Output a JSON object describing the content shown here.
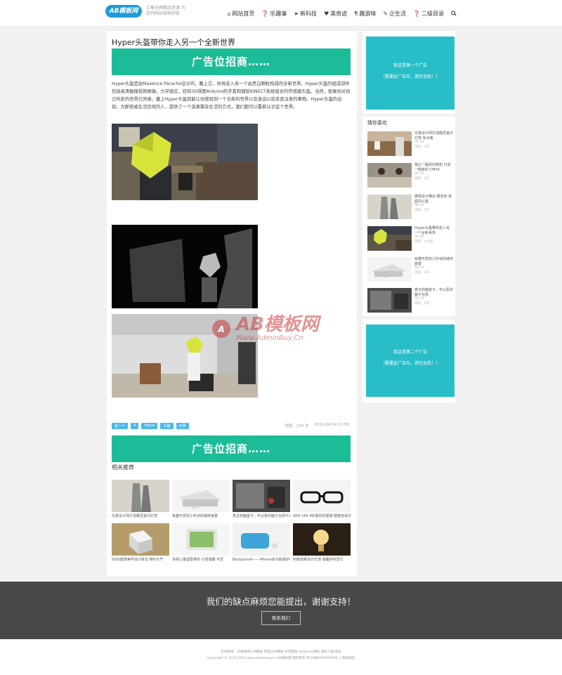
{
  "header": {
    "logo_text": "AB模板网",
    "logo_tagline": "汇聚全网精品资源 为您的网站保驾护航",
    "nav": [
      {
        "icon": "home-icon",
        "glyph": "⌂",
        "label": "网站首页"
      },
      {
        "icon": "help-icon",
        "glyph": "❓",
        "label": "乐趣事"
      },
      {
        "icon": "send-icon",
        "glyph": "➤",
        "label": "新科技"
      },
      {
        "icon": "heart-icon",
        "glyph": "♥",
        "label": "美奇迹"
      },
      {
        "icon": "cutlery-icon",
        "glyph": "¶",
        "label": "趣游味"
      },
      {
        "icon": "tag-icon",
        "glyph": "✎",
        "label": "企生活"
      },
      {
        "icon": "help-icon",
        "glyph": "❓",
        "label": "二级目录"
      }
    ],
    "search_icon": "search-icon"
  },
  "article": {
    "title": "Hyper头盔带你走入另一个全新世界",
    "ad_text": "广告位招商……",
    "paragraphs": [
      "Hyper头盔是由Maxence Parache设计的，戴上它，你将走入另一个由黑白颗粒构成的全新世界。Hyper头盔的组成部件包括高清触摸视频眼镜，力学感应，控制3D视图Arduino的手套和微软KINECT系统组合的传感器头盔。当然，如果你对自己所处的世界已厌倦，戴上Hyper头盔就能让你感觉到一个全新的世界以及身边以前未曾注意的事物。Hyper头盔的出现，为那些被生活压垮的人，提供了一个逃离繁杂生活的方式，我们都可以重新认识这个世界。"
    ],
    "tags": [
      "有一个",
      "X",
      "Hyper",
      "头盔",
      "世界"
    ],
    "views": "浏览：170 次",
    "date": "2015-04-19 11:56",
    "ad_text_2": "广告位招商……"
  },
  "related": {
    "title": "相关推荐",
    "items": [
      "伦敦设计师打造概念室内灯饰",
      "有趣可爱的小形状的储存装置",
      "真正的脑室卡，可以看你脑子在想什么",
      "DHS 165 MD看你的墨镜 眼镜自动清洗",
      "SIXO建筑美学设计珠宝 简约大气",
      "多网儿童益智类的 沙发有趣 可爱",
      "Backpocket——iPhone多功能保护壳",
      "利用创意设计灯泡 有趣的可爱灯"
    ]
  },
  "sidebar": {
    "ad1_lines": [
      "我这是第一个广告",
      "（需要此广告位，请先加我！）"
    ],
    "list_title": "猜你喜欢",
    "items": [
      {
        "title": "伦敦设计师打造概念室内灯饰 有点美",
        "date": "04-19",
        "views": "浏览：1次"
      },
      {
        "title": "独立一般的印刷机 打造一款新的 CMYK",
        "date": "04-19",
        "views": "浏览：2次"
      },
      {
        "title": "德拜设计推出 概念床 家庭办公室",
        "date": "04-19",
        "views": "浏览：3次"
      },
      {
        "title": "Hyper头盔带你走入另一个全新世界",
        "date": "04-19",
        "views": "浏览：170次"
      },
      {
        "title": "有趣可爱的小形状的储存装置",
        "date": "04-19",
        "views": "浏览：4次"
      },
      {
        "title": "真正的脑室卡，可以看你脑子在想",
        "date": "04-19",
        "views": "浏览：5次"
      }
    ],
    "ad2_lines": [
      "我这是第二个广告",
      "（需要此广告位，请先加我！）"
    ]
  },
  "footer": {
    "message": "我们的缺点麻烦您能提出，谢谢支持！",
    "button": "联系我们",
    "line1": "友情链接：AB模板网 AB模板 帝国CMS模板 织梦模板 dedecms模板 源码下载 建站",
    "line2": "Copyright © 2015-2016 www.adminbuy.cn AB模板网 版权所有   苏ICP备00000000号-1 网站地图"
  },
  "watermark": {
    "text": "AB模板网",
    "url": "Www.AdminBuy.Cn"
  }
}
